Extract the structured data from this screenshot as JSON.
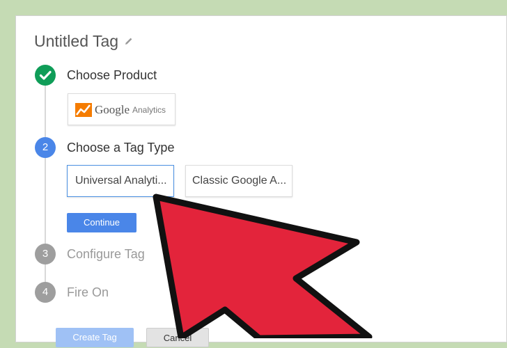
{
  "colors": {
    "background": "#c5dbb4",
    "step_done": "#0f9d58",
    "step_active": "#4a86e8",
    "step_inactive": "#9e9e9e",
    "continue_button": "#4a86e8",
    "create_button": "#9fc1f5",
    "arrow_fill": "#e3243b",
    "arrow_stroke": "#111111"
  },
  "page": {
    "title": "Untitled Tag",
    "edit_icon": "pencil-icon"
  },
  "steps": [
    {
      "number": "",
      "label": "Choose Product",
      "state": "done",
      "icon": "check-icon"
    },
    {
      "number": "2",
      "label": "Choose a Tag Type",
      "state": "active"
    },
    {
      "number": "3",
      "label": "Configure Tag",
      "state": "inactive"
    },
    {
      "number": "4",
      "label": "Fire On",
      "state": "inactive"
    }
  ],
  "product": {
    "logo_icon": "google-analytics-icon",
    "brand": "Google",
    "product": "Analytics"
  },
  "tag_types": [
    {
      "label": "Universal Analyti...",
      "selected": true
    },
    {
      "label": "Classic Google A...",
      "selected": false
    }
  ],
  "buttons": {
    "continue": "Continue",
    "create": "Create Tag",
    "cancel": "Cancel"
  }
}
